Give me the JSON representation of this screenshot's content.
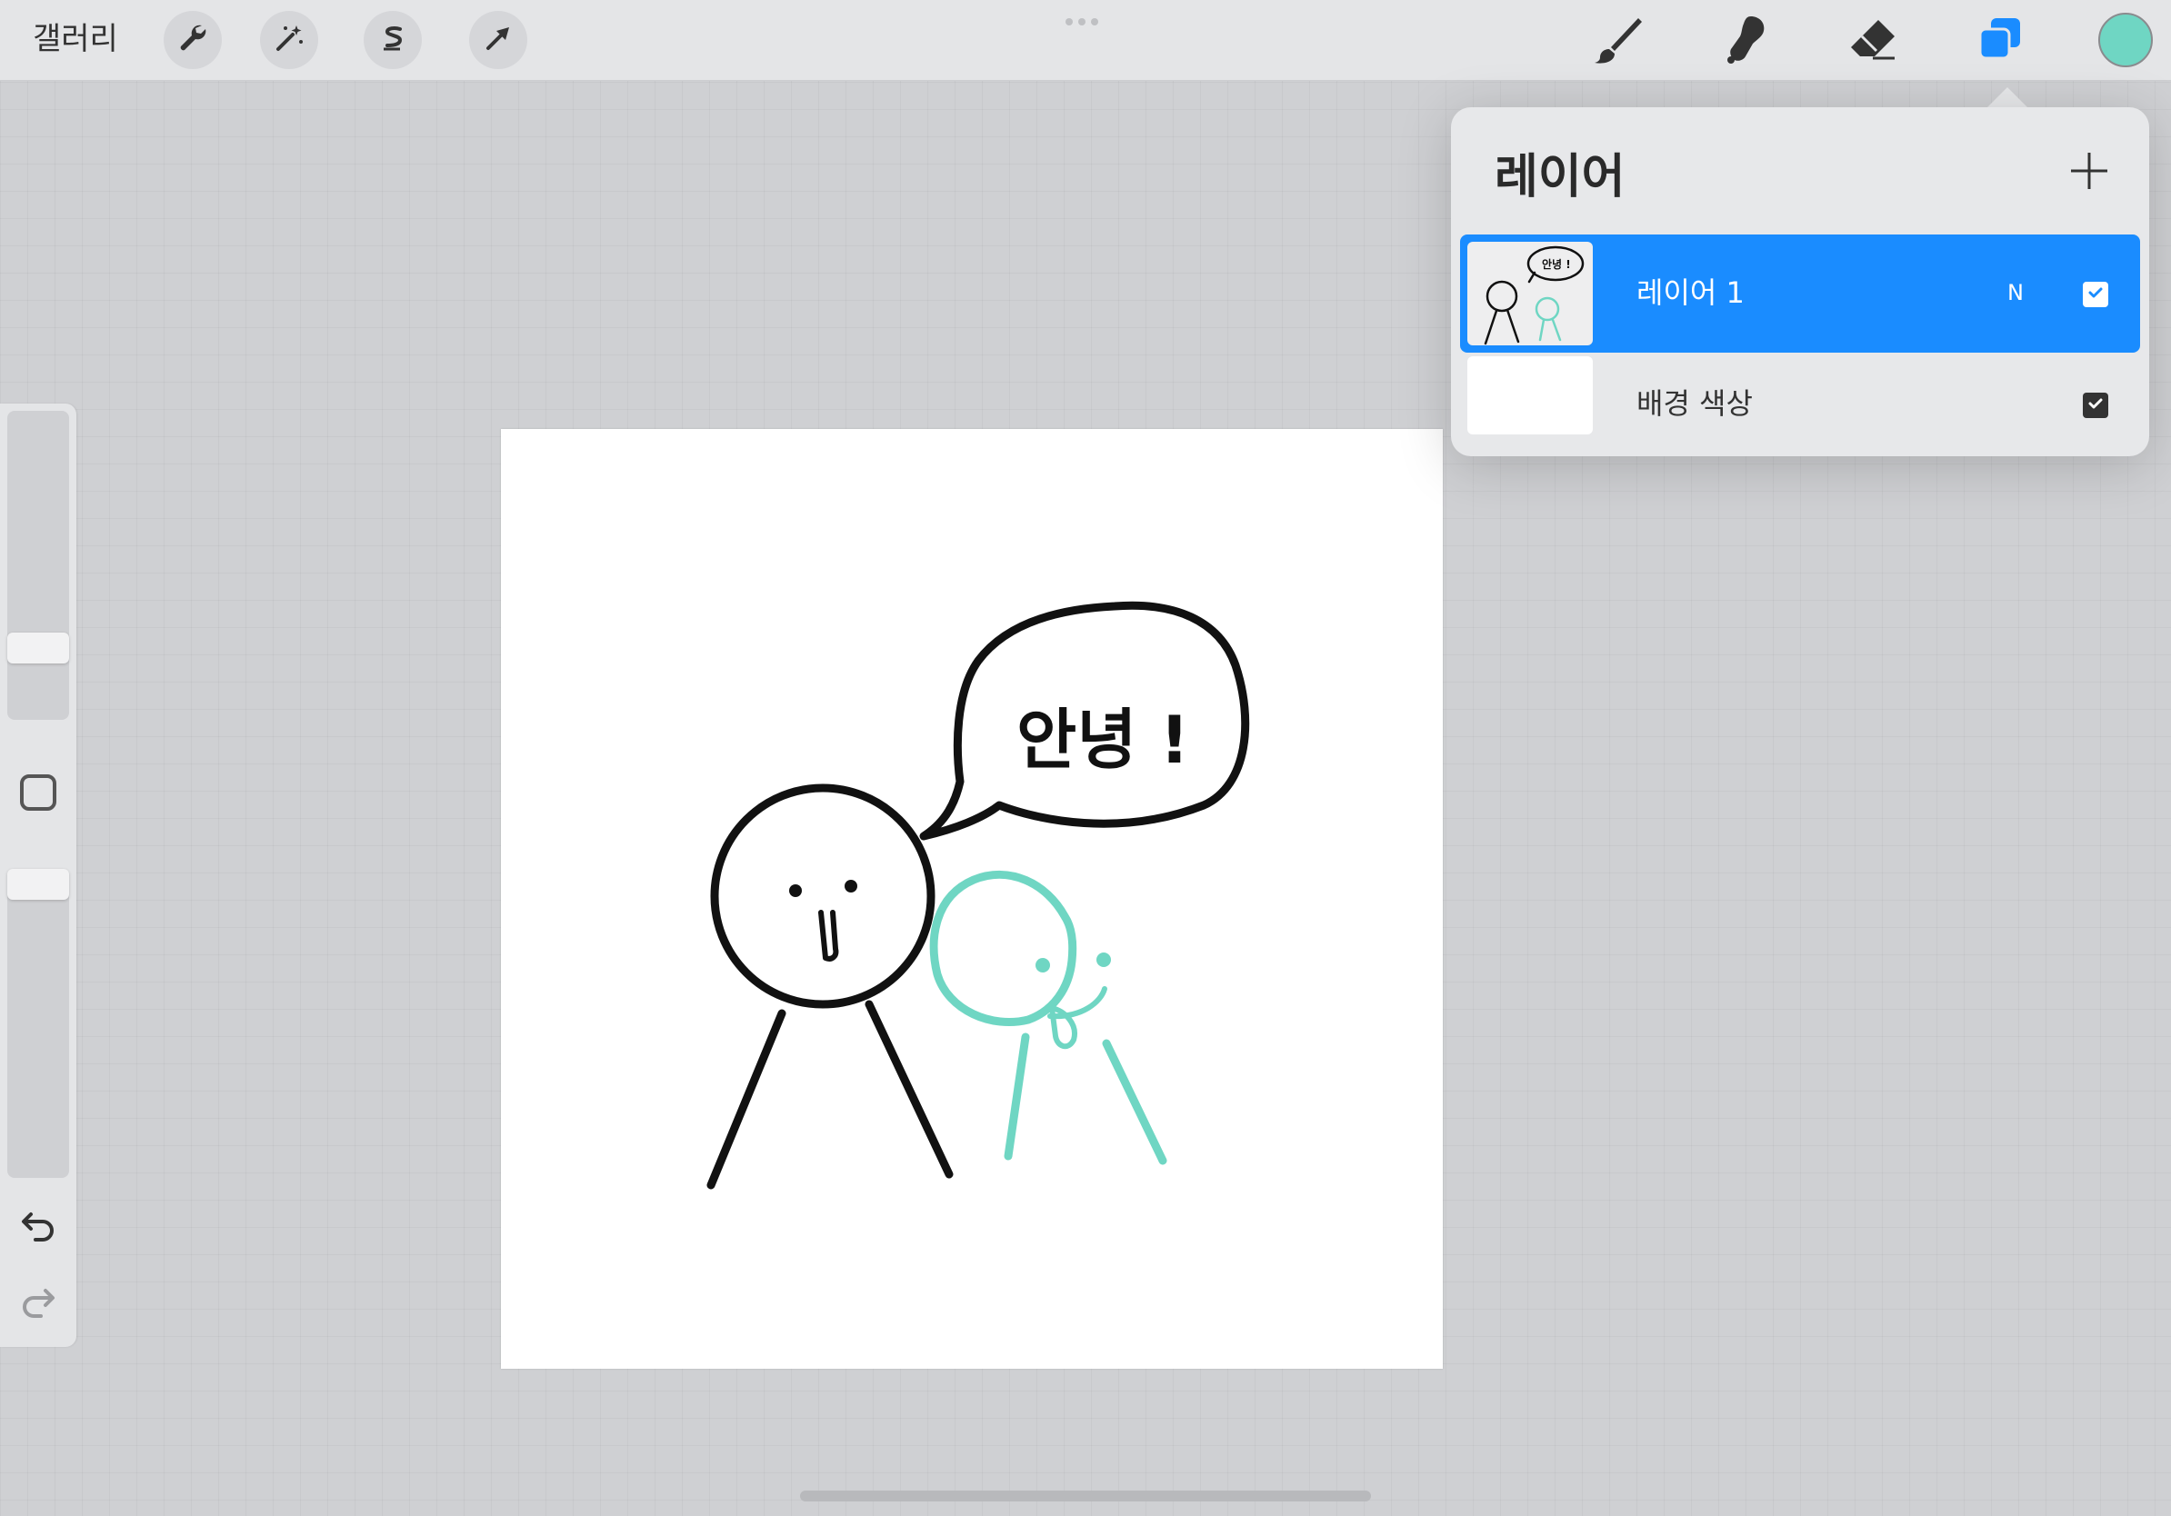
{
  "topbar": {
    "gallery_label": "갤러리",
    "left_tools": [
      "wrench-icon",
      "magic-wand-icon",
      "selection-icon",
      "transform-arrow-icon"
    ],
    "right_tools": [
      "brush-icon",
      "smudge-icon",
      "eraser-icon",
      "layers-icon"
    ],
    "current_color": "#6fd6c3"
  },
  "canvas": {
    "speech_text": "안녕 !",
    "ink_color": "#111111",
    "friend_color": "#6fd6c3"
  },
  "layers_panel": {
    "title": "레이어",
    "add_symbol": "+",
    "layers": [
      {
        "name": "레이어 1",
        "blend_mode": "N",
        "visible": true,
        "selected": true
      },
      {
        "name": "배경 색상",
        "blend_mode": "",
        "visible": true,
        "selected": false
      }
    ]
  },
  "colors": {
    "accent": "#1a8cff",
    "panel": "#e7e8ea"
  }
}
